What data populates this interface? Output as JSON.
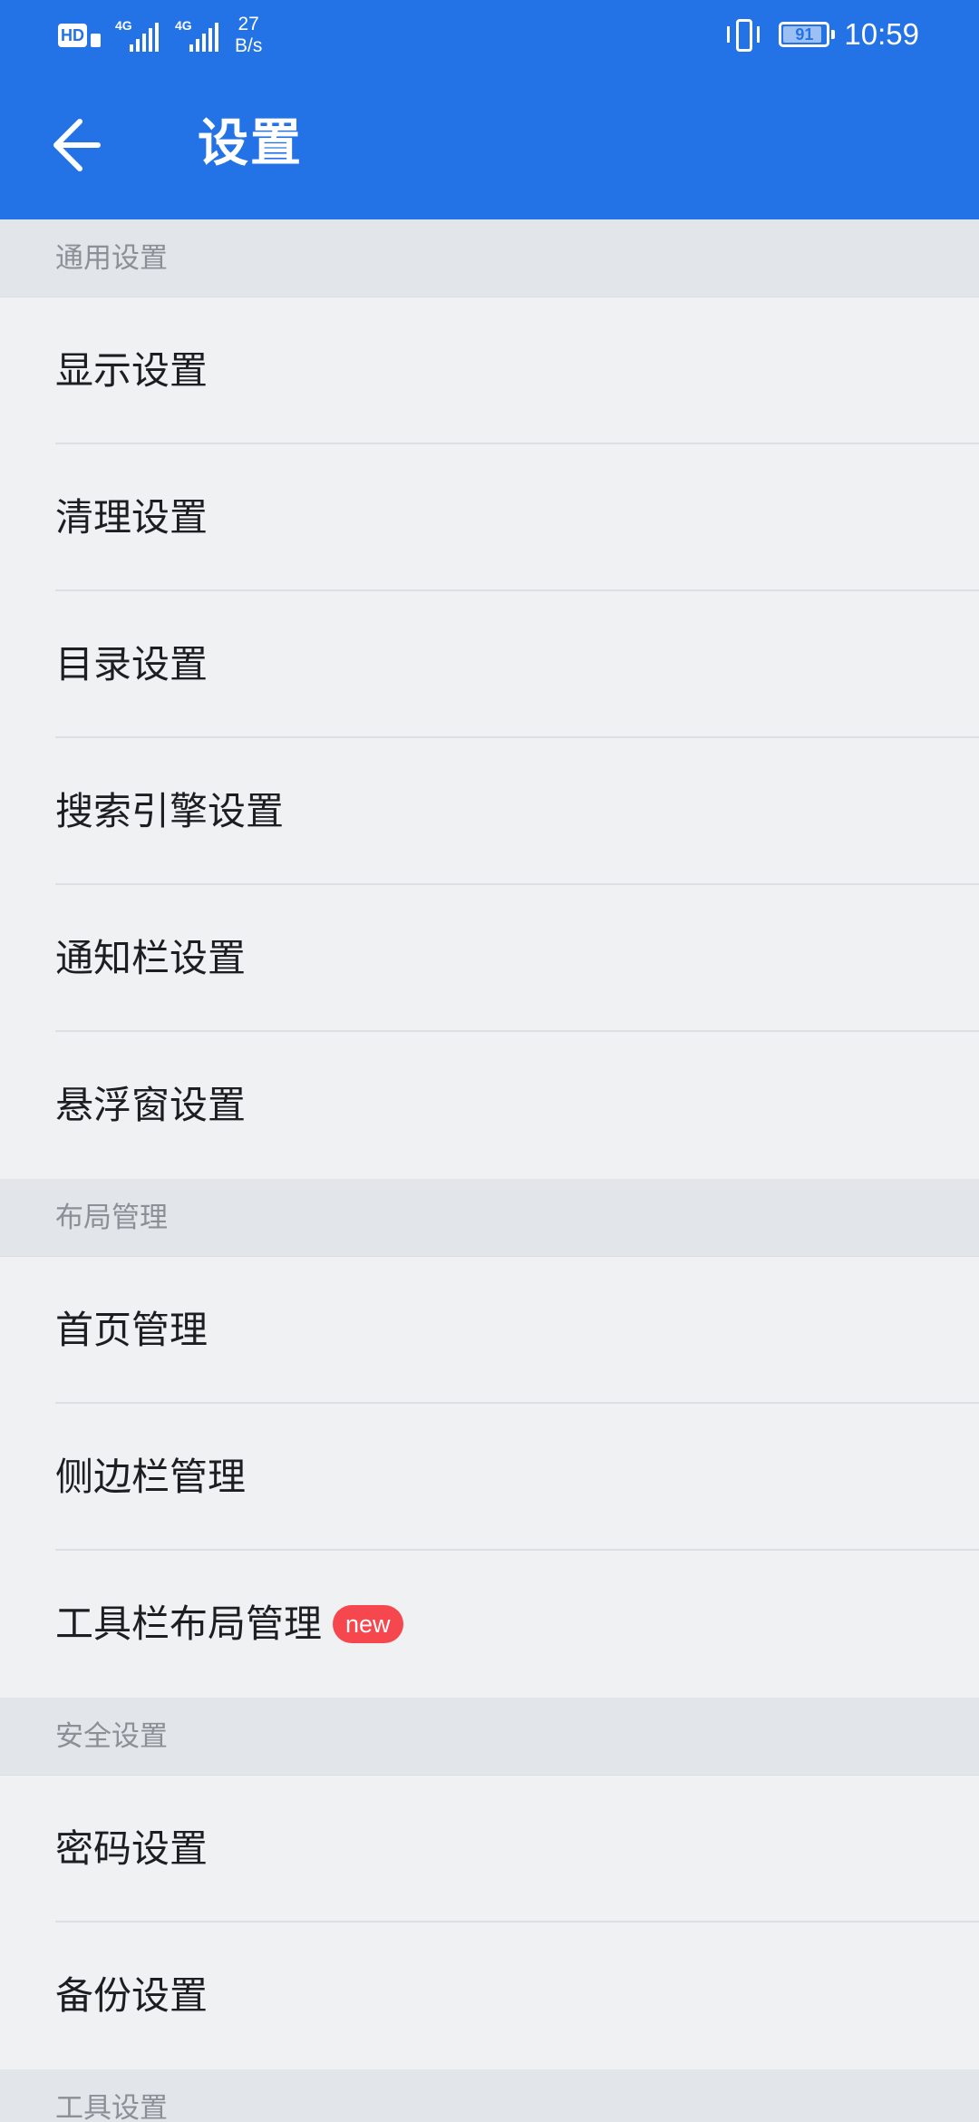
{
  "status_bar": {
    "hd_label": "HD",
    "signal_1": "4G",
    "signal_2": "4G",
    "net_speed_value": "27",
    "net_speed_unit": "B/s",
    "battery_level": "91",
    "time": "10:59"
  },
  "app_bar": {
    "back_icon": "arrow-left-icon",
    "title": "设置"
  },
  "colors": {
    "header_bg": "#2473e6",
    "page_bg": "#f0f1f3",
    "section_bg": "#e2e5e9",
    "new_badge": "#f5474d"
  },
  "sections": [
    {
      "title": "通用设置",
      "items": [
        {
          "label": "显示设置"
        },
        {
          "label": "清理设置"
        },
        {
          "label": "目录设置"
        },
        {
          "label": "搜索引擎设置"
        },
        {
          "label": "通知栏设置"
        },
        {
          "label": "悬浮窗设置"
        }
      ]
    },
    {
      "title": "布局管理",
      "items": [
        {
          "label": "首页管理"
        },
        {
          "label": "侧边栏管理"
        },
        {
          "label": "工具栏布局管理",
          "badge": "new"
        }
      ]
    },
    {
      "title": "安全设置",
      "items": [
        {
          "label": "密码设置"
        },
        {
          "label": "备份设置"
        }
      ]
    },
    {
      "title": "工具设置",
      "items": []
    }
  ]
}
